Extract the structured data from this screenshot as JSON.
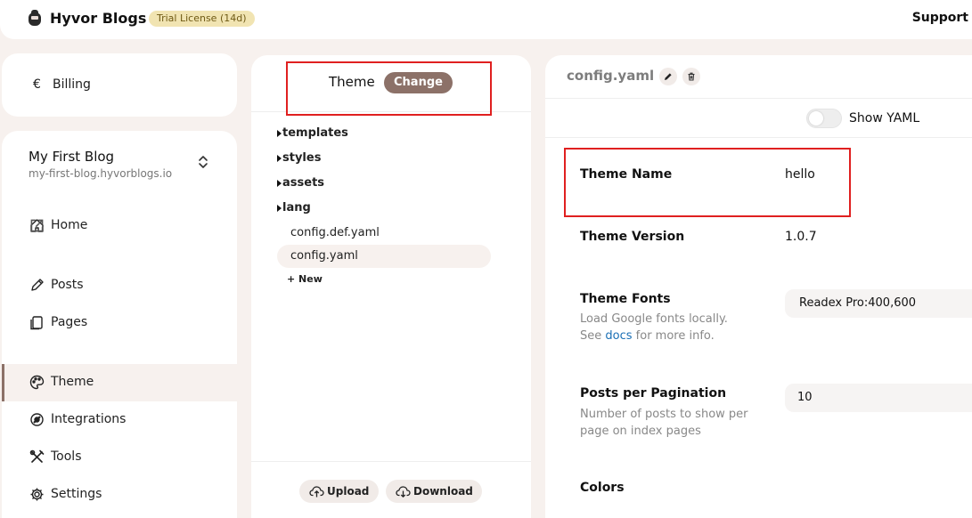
{
  "topbar": {
    "brand": "Hyvor Blogs",
    "trial_badge": "Trial License (14d)",
    "support": "Support"
  },
  "billing": {
    "currency_symbol": "€",
    "label": "Billing"
  },
  "blog": {
    "name": "My First Blog",
    "url": "my-first-blog.hyvorblogs.io"
  },
  "nav": {
    "home": "Home",
    "posts": "Posts",
    "pages": "Pages",
    "theme": "Theme",
    "integrations": "Integrations",
    "tools": "Tools",
    "settings": "Settings"
  },
  "files": {
    "header_label": "Theme",
    "change_label": "Change",
    "folders": [
      "templates",
      "styles",
      "assets",
      "lang"
    ],
    "file_list": [
      "config.def.yaml",
      "config.yaml"
    ],
    "selected_file": "config.yaml",
    "new_label": "+ New",
    "upload_label": "Upload",
    "download_label": "Download"
  },
  "editor": {
    "title": "config.yaml",
    "show_yaml_label": "Show YAML",
    "show_yaml_on": false,
    "fields": {
      "theme_name": {
        "label": "Theme Name",
        "value": "hello"
      },
      "theme_version": {
        "label": "Theme Version",
        "value": "1.0.7"
      },
      "theme_fonts": {
        "label": "Theme Fonts",
        "help_line1": "Load Google fonts locally.",
        "help_see": "See",
        "help_link": "docs",
        "help_rest": "for more info.",
        "value": "Readex Pro:400,600"
      },
      "posts_per_pagination": {
        "label": "Posts per Pagination",
        "help": "Number of posts to show per page on index pages",
        "value": "10"
      },
      "colors": {
        "label": "Colors"
      }
    }
  },
  "colors": {
    "accent": "#8c7168",
    "highlight_box": "#e02020",
    "background": "#f7f1ee",
    "trial_badge_bg": "#f1e4b2",
    "link": "#1a6fb5"
  }
}
